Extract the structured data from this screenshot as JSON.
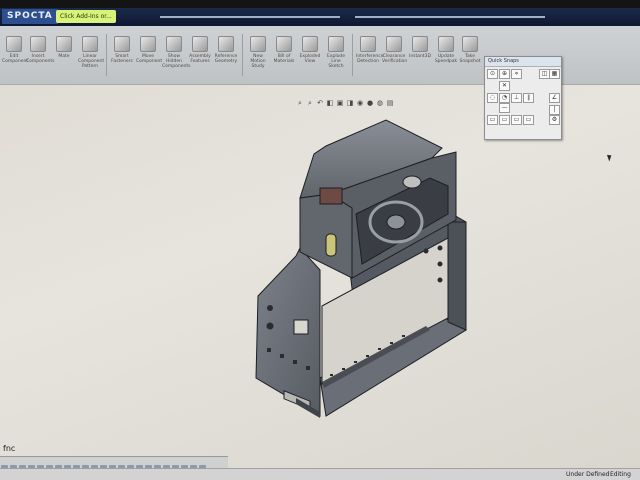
{
  "window": {
    "brand": "SPOCTA",
    "tip": "Click Add-Ins or..."
  },
  "command_manager": {
    "buttons": [
      "Edit Component",
      "Insert Components",
      "Mate",
      "Linear Component Pattern",
      "Smart Fasteners",
      "Move Component",
      "Show Hidden Components",
      "Assembly Features",
      "Reference Geometry",
      "New Motion Study",
      "Bill of Materials",
      "Exploded View",
      "Explode Line Sketch",
      "Interference Detection",
      "Clearance Verification",
      "Instant3D",
      "Update Speedpak",
      "Take Snapshot"
    ]
  },
  "palette": {
    "title": "Quick Snaps"
  },
  "status_bar": {
    "state": "Under Defined",
    "mode": "Editing Assembly"
  },
  "bottom_tab": {
    "label": "fnc"
  },
  "colors": {
    "part": "#6b7079",
    "part_dark": "#3f434a",
    "edge": "#1d1f23",
    "background": "#e3e1da"
  }
}
